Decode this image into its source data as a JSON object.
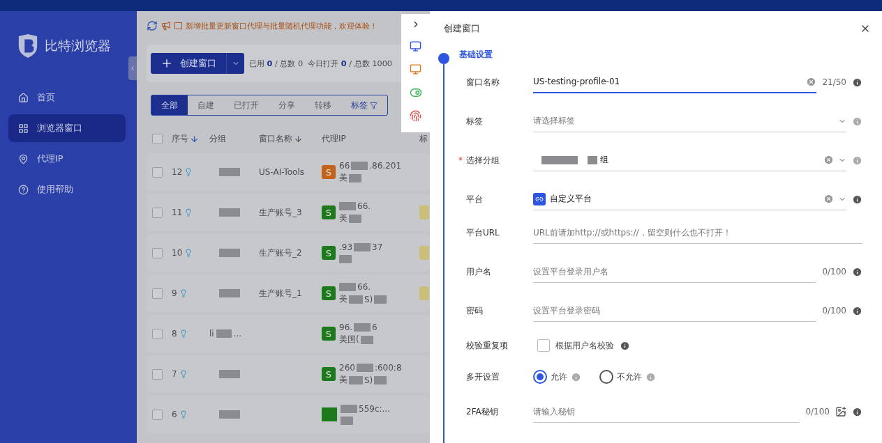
{
  "sidebar": {
    "logo": "比特浏览器",
    "items": [
      {
        "kind": "home",
        "label": "首页",
        "selected": false
      },
      {
        "kind": "grid",
        "label": "浏览器窗口",
        "selected": true
      },
      {
        "kind": "pin",
        "label": "代理IP",
        "selected": false
      },
      {
        "kind": "help",
        "label": "使用帮助",
        "selected": false
      }
    ]
  },
  "notice": "新增批量更新窗口代理与批量随机代理功能，欢迎体验！",
  "toolbar": {
    "create_button": "创建窗口",
    "stats": [
      {
        "label": "已用",
        "value": "0",
        "total": "/ 总数 0"
      },
      {
        "label": "今日打开",
        "value": "0",
        "total": "/ 总数 1000"
      }
    ]
  },
  "filter_tabs": [
    {
      "label": "全部",
      "selected": true,
      "kind": "tab"
    },
    {
      "label": "自建",
      "selected": false,
      "kind": "tab"
    },
    {
      "label": "已打开",
      "selected": false,
      "kind": "tab"
    },
    {
      "label": "分享",
      "selected": false,
      "kind": "tab"
    },
    {
      "label": "转移",
      "selected": false,
      "kind": "tab"
    },
    {
      "label": "标签",
      "selected": false,
      "kind": "filter"
    }
  ],
  "table": {
    "select_all_checked": false,
    "columns": [
      {
        "label": "序号",
        "sortable": true
      },
      {
        "label": "分组",
        "sortable": false
      },
      {
        "label": "窗口名称",
        "sortable": true
      },
      {
        "label": "代理IP",
        "sortable": false
      },
      {
        "label": "标",
        "sortable": false
      }
    ],
    "rows": [
      {
        "checked": false,
        "index": "12",
        "name": "US-AI-Tools",
        "proxy": {
          "badge": "S",
          "color": "#c4621a",
          "ip": [
            "66",
            ".86.201"
          ],
          "country": [
            "美"
          ]
        },
        "tagged": false
      },
      {
        "checked": false,
        "index": "11",
        "name": "生产账号_3",
        "proxy": {
          "badge": "S",
          "color": "#1c7a1c",
          "ip": [
            "66."
          ],
          "country": [
            "美"
          ]
        },
        "tagged": true
      },
      {
        "checked": false,
        "index": "10",
        "name": "生产账号_2",
        "proxy": {
          "badge": "S",
          "color": "#1c7a1c",
          "ip": [
            ".93",
            "37"
          ]
        },
        "tagged": true
      },
      {
        "checked": false,
        "index": "9",
        "name": "生产账号_1",
        "proxy": {
          "badge": "S",
          "color": "#1c7a1c",
          "ip": [
            "66."
          ],
          "country": [
            "美",
            "S)"
          ]
        },
        "tagged": true
      },
      {
        "checked": false,
        "index": "8",
        "group": [
          "li",
          "..."
        ],
        "proxy": {
          "badge": "S",
          "color": "#1c7a1c",
          "ip": [
            "96.",
            "6"
          ],
          "country": [
            "美国("
          ]
        },
        "tagged": false
      },
      {
        "checked": false,
        "index": "7",
        "proxy": {
          "badge": "S",
          "color": "#1c7a1c",
          "ip": [
            "260",
            ":600:8"
          ],
          "country": [
            "美",
            "S)"
          ]
        },
        "tagged": false
      },
      {
        "checked": false,
        "index": "6",
        "proxy": {
          "color": "#1c7a1c",
          "ip": [
            "559c:..."
          ]
        },
        "tagged": false
      }
    ]
  },
  "drawer": {
    "title": "创建窗口",
    "step": "基础设置",
    "fields": [
      {
        "kind": "text",
        "label": "窗口名称",
        "value": "US-testing-profile-01",
        "counter": "21/50",
        "clearable": true,
        "focused": true,
        "info": true,
        "info_muted": false
      },
      {
        "kind": "select",
        "label": "标签",
        "placeholder": "请选择标签",
        "info": true,
        "info_muted": true
      },
      {
        "kind": "select",
        "label": "选择分组",
        "required_mark": "*",
        "value": "组",
        "redacted": true,
        "clearable": true,
        "info": true,
        "info_muted": true
      },
      {
        "kind": "select",
        "label": "平台",
        "value": "自定义平台",
        "platform_icon": true,
        "clearable": true,
        "info": true,
        "info_muted": false
      },
      {
        "kind": "text",
        "label": "平台URL",
        "placeholder": "URL前请加http://或https://，留空则什么也不打开！"
      },
      {
        "kind": "text",
        "label": "用户名",
        "placeholder": "设置平台登录用户名",
        "counter": "0/100",
        "info": true,
        "info_muted": false
      },
      {
        "kind": "text",
        "label": "密码",
        "placeholder": "设置平台登录密码",
        "counter": "0/100",
        "info": true,
        "info_muted": false
      },
      {
        "kind": "checkbox",
        "label": "校验重复项",
        "option": "根据用户名校验",
        "checked": false
      },
      {
        "kind": "radio",
        "label": "多开设置",
        "options": [
          {
            "label": "允许",
            "selected": true
          },
          {
            "label": "不允许",
            "selected": false
          }
        ]
      },
      {
        "kind": "text",
        "label": "2FA秘钥",
        "placeholder": "请输入秘钥",
        "counter": "0/100",
        "image_button": true,
        "info": true,
        "info_muted": false
      }
    ]
  }
}
